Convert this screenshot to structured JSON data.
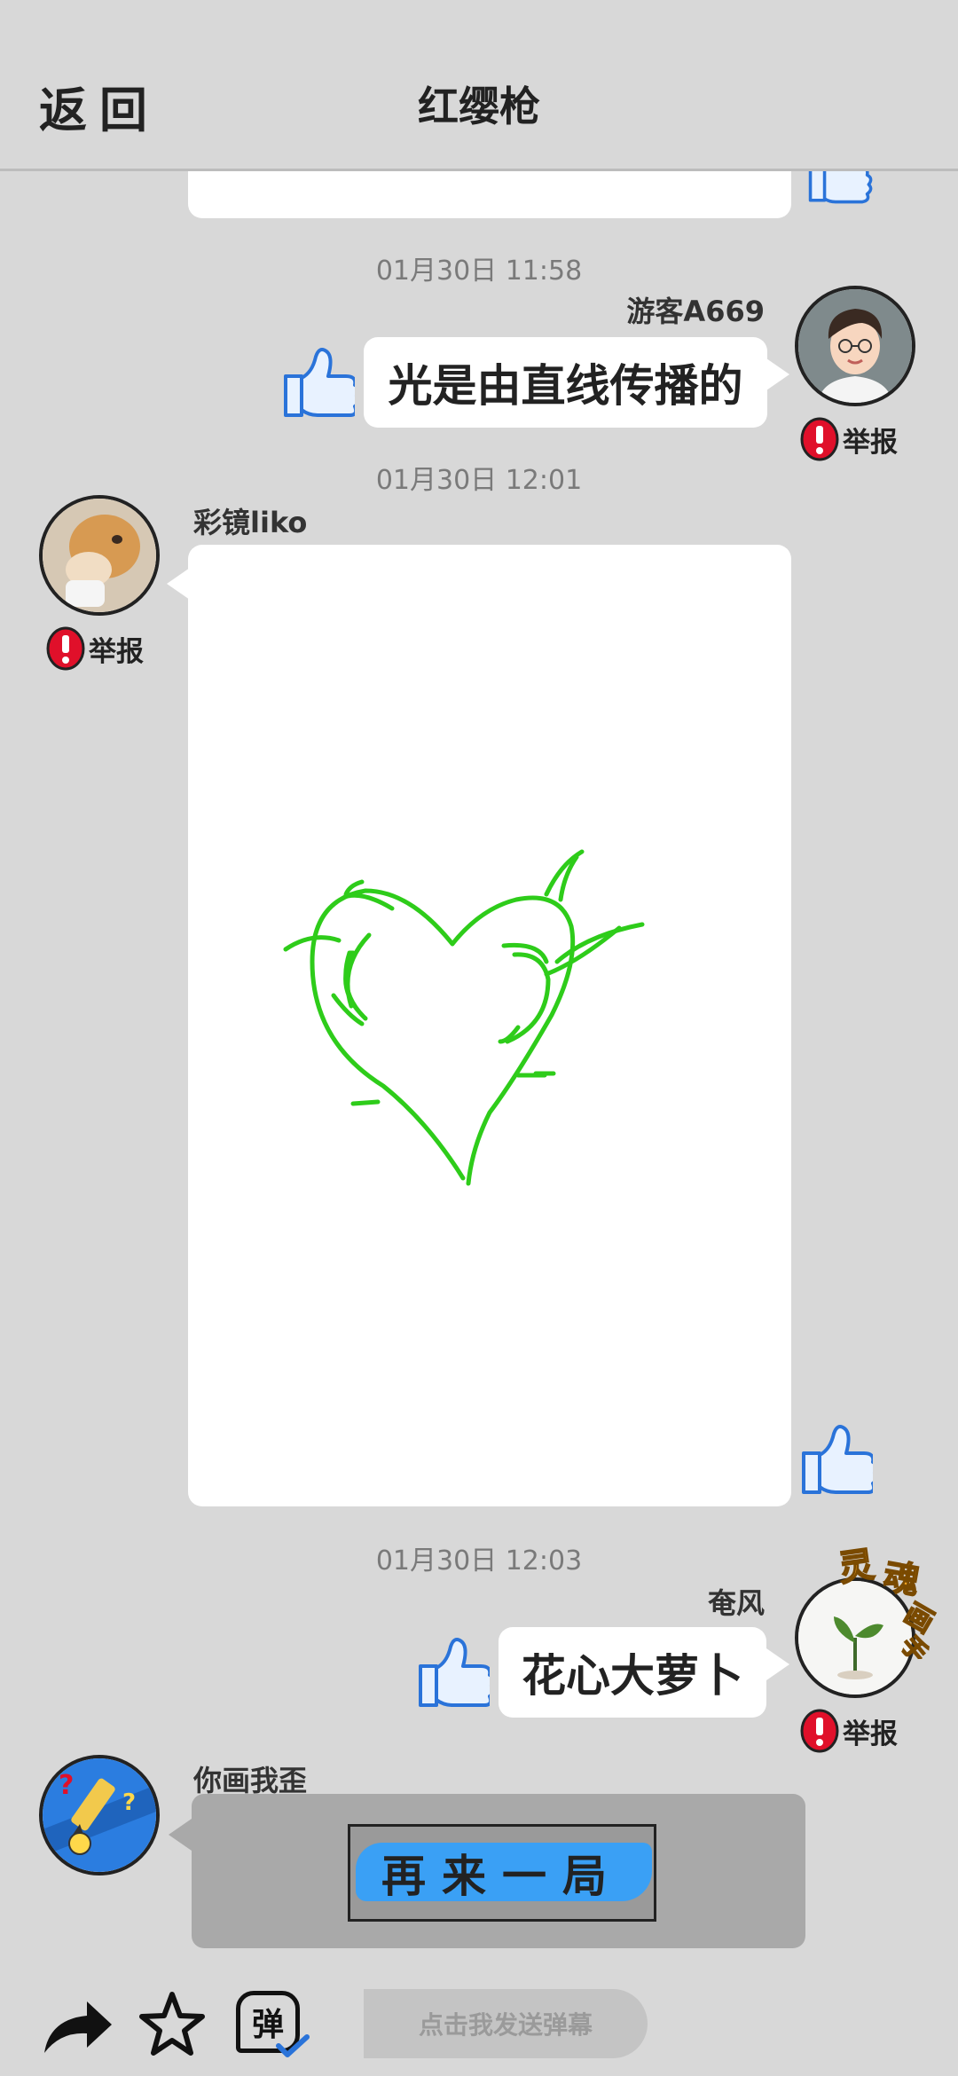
{
  "header": {
    "back_label": "返回",
    "title": "红缨枪"
  },
  "messages": [
    {
      "timestamp": "01月30日  11:58",
      "user": "游客A669",
      "text": "光是由直线传播的",
      "report_label": "举报",
      "side": "right"
    },
    {
      "timestamp": "01月30日  12:01",
      "user": "彩镜liko",
      "type": "drawing",
      "report_label": "举报",
      "side": "left"
    },
    {
      "timestamp": "01月30日  12:03",
      "user": "奄风",
      "text": "花心大萝卜",
      "report_label": "举报",
      "avatar_badge": "灵魂画手",
      "side": "right"
    },
    {
      "user": "你画我歪",
      "button_label": "再来一局",
      "side": "left"
    }
  ],
  "footer": {
    "danmu_icon_char": "弹",
    "send_danmu_label": "点击我发送弹幕"
  },
  "colors": {
    "background": "#d8d8d8",
    "bubble": "#ffffff",
    "like_blue": "#2a73d9",
    "report_red": "#e0102a",
    "heart_green": "#2ecc1a",
    "replay_blue": "#3aa0f5"
  }
}
